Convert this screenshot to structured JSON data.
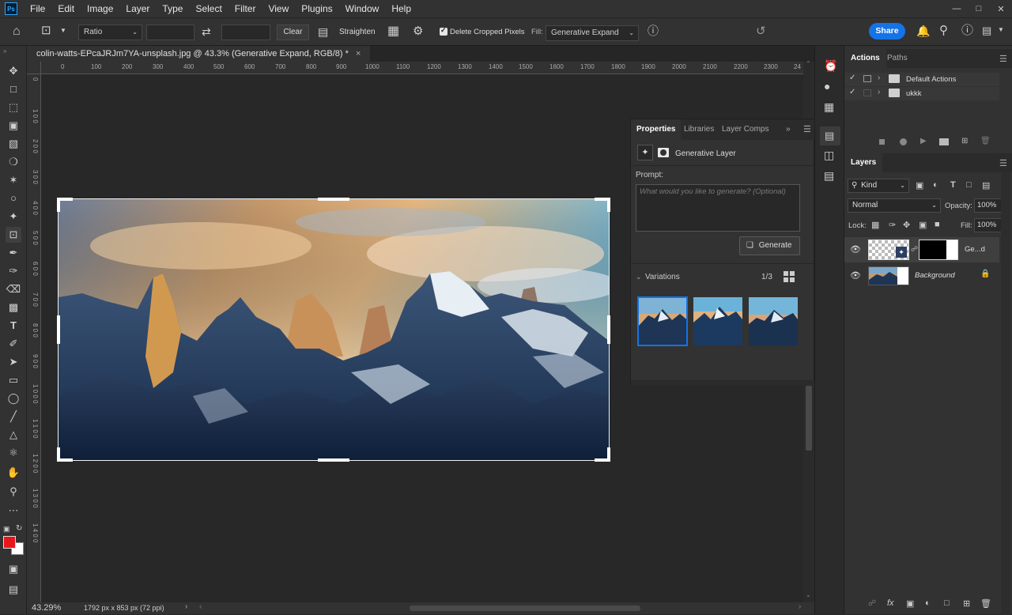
{
  "menubar": {
    "logo": "Ps",
    "items": [
      "File",
      "Edit",
      "Image",
      "Layer",
      "Type",
      "Select",
      "Filter",
      "View",
      "Plugins",
      "Window",
      "Help"
    ]
  },
  "optionsbar": {
    "ratio_select": "Ratio",
    "clear_label": "Clear",
    "straighten_label": "Straighten",
    "delete_cropped_label": "Delete Cropped Pixels",
    "fill_label": "Fill:",
    "fill_value": "Generative Expand",
    "share_label": "Share"
  },
  "document": {
    "tab_title": "colin-watts-EPcaJRJm7YA-unsplash.jpg @ 43.3% (Generative Expand, RGB/8) *",
    "ruler_h": [
      "0",
      "100",
      "200",
      "300",
      "400",
      "500",
      "600",
      "700",
      "800",
      "900",
      "1000",
      "1100",
      "1200",
      "1300",
      "1400",
      "1500",
      "1600",
      "1700",
      "1800",
      "1900",
      "2000",
      "2100",
      "2200",
      "2300",
      "24"
    ],
    "ruler_v": [
      "0",
      "1 0 0",
      "2 0 0",
      "3 0 0",
      "4 0 0",
      "5 0 0",
      "6 0 0",
      "7 0 0",
      "8 0 0",
      "9 0 0",
      "1 0 0 0",
      "1 1 0 0",
      "1 2 0 0",
      "1 3 0 0",
      "1 4 0 0"
    ]
  },
  "status": {
    "zoom": "43.29%",
    "dimensions": "1792 px x 853 px (72 ppi)"
  },
  "properties": {
    "tabs": [
      "Properties",
      "Libraries",
      "Layer Comps"
    ],
    "layer_type": "Generative Layer",
    "prompt_label": "Prompt:",
    "prompt_placeholder": "What would you like to generate? (Optional)",
    "generate_label": "Generate",
    "variations_label": "Variations",
    "variations_count": "1/3"
  },
  "actions": {
    "tabs": [
      "Actions",
      "Paths"
    ],
    "items": [
      {
        "label": "Default Actions"
      },
      {
        "label": "ukkk"
      }
    ]
  },
  "layers": {
    "tab": "Layers",
    "filter_kind": "Kind",
    "blend_mode": "Normal",
    "opacity_label": "Opacity:",
    "opacity_value": "100%",
    "lock_label": "Lock:",
    "fill_label": "Fill:",
    "fill_value": "100%",
    "items": [
      {
        "name": "Ge...d"
      },
      {
        "name": "Background"
      }
    ]
  },
  "colors": {
    "accent": "#1473e6",
    "foreground": "#e8161b",
    "background": "#ffffff"
  }
}
